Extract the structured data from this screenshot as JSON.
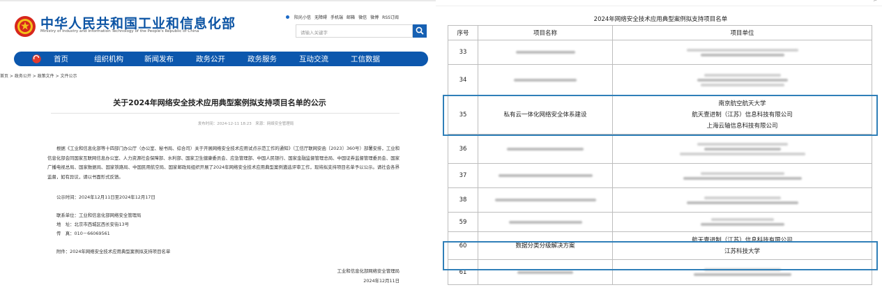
{
  "left": {
    "site_title": "中华人民共和国工业和信息化部",
    "site_subtitle": "Ministry of Industry and Information Technology of the People's Republic of China",
    "util_links": [
      "阳光小信",
      "无障碍",
      "手机端",
      "邮箱",
      "微信",
      "微博",
      "RSS订阅"
    ],
    "search_placeholder": "请输入关键字",
    "nav": [
      "首页",
      "组织机构",
      "新闻发布",
      "政务公开",
      "政务服务",
      "互动交流",
      "工信数据"
    ],
    "breadcrumb": "首页 > 政务公开 > 政策文件 > 文件公示",
    "title": "关于2024年网络安全技术应用典型案例拟支持项目名单的公示",
    "meta": "发布时间：2024-12-11 18:23　来源：网络安全管理局",
    "paragraph": "根据《工业和信息化部等十四部门办公厅（办公室、秘书局、综合司）关于开展网络安全技术应用试点示范工作的通知》（工信厅联网安函〔2023〕360号）部署安排，工业和信息化部会同国家互联网信息办公室、人力资源社会保障部、水利部、国家卫生健康委员会、应急管理部、中国人民银行、国家金融监督管理总局、中国证券监督管理委员会、国家广播电视总局、国家数据局、国家铁路局、中国民用航空局、国家邮政局组织开展了2024年网络安全技术应用典型案例遴选评审工作，现将拟支持项目名单予以公示。请社会各界监督，如有异议，请以书面形式反馈。",
    "publicity_period": "公示时间：2024年12月11日至2024年12月17日",
    "contact_unit": "联系单位：工业和信息化部网络安全管理局",
    "address": "地　址：北京市西城区西长安街13号",
    "fax": "传　真：010－66069561",
    "attachment": "附件：2024年网络安全技术应用典型案例拟支持项目名单",
    "sign_org": "工业和信息化部网络安全管理局",
    "sign_date": "2024年12月11日"
  },
  "right": {
    "caption": "2024年网络安全技术应用典型案例拟支持项目名单",
    "headers": [
      "序号",
      "项目名称",
      "项目单位"
    ],
    "rows": [
      {
        "no": "33",
        "name": "",
        "units": []
      },
      {
        "no": "34",
        "name": "",
        "units": []
      },
      {
        "no": "35",
        "name": "私有云一体化网络安全体系建设",
        "units": [
          "南京航空航天大学",
          "航天壹进制（江苏）信息科技有限公司",
          "上海云轴信息科技有限公司"
        ]
      },
      {
        "no": "36",
        "name": "",
        "units": []
      },
      {
        "no": "37",
        "name": "",
        "units": []
      },
      {
        "no": "38",
        "name": "",
        "units": []
      },
      {
        "no": "59",
        "name": "",
        "units": []
      },
      {
        "no": "60",
        "name": "数据分类分级解决方案",
        "units": [
          "航天壹进制（江苏）信息科技有限公司",
          "江苏科技大学"
        ]
      },
      {
        "no": "61",
        "name": "",
        "units": []
      }
    ]
  },
  "colors": {
    "brand_blue": "#0c57ad",
    "highlight_border": "#2f7fb8"
  }
}
